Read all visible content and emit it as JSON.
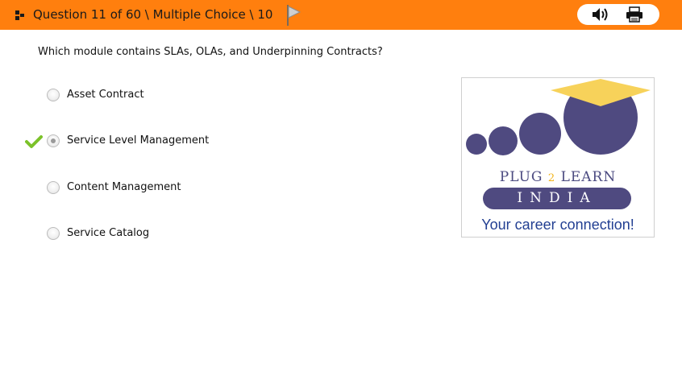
{
  "header": {
    "title": "Question 11 of 60 \\ Multiple Choice \\ 10",
    "background_color": "#ff7f0e",
    "question_icon": "question-marker-icon",
    "flag_icon": "flag-icon",
    "tools": [
      {
        "name": "audio",
        "icon": "speaker-icon"
      },
      {
        "name": "print",
        "icon": "printer-icon"
      }
    ]
  },
  "question": {
    "text": "Which module contains SLAs, OLAs, and Underpinning Contracts?"
  },
  "options": [
    {
      "label": "Asset Contract",
      "selected": false,
      "correct": false
    },
    {
      "label": "Service Level Management",
      "selected": true,
      "correct": true
    },
    {
      "label": "Content Management",
      "selected": false,
      "correct": false
    },
    {
      "label": "Service Catalog",
      "selected": false,
      "correct": false
    }
  ],
  "feedback": {
    "correct_icon": "green-checkmark-icon",
    "correct_color": "#7cc22a"
  },
  "logo": {
    "brand_pre": "PLUG",
    "brand_mid": "2",
    "brand_post": "LEARN",
    "country": "INDIA",
    "tagline": "Your career connection!",
    "colors": {
      "purple": "#4f4a80",
      "gold": "#f7d25a",
      "blue": "#223f92"
    }
  }
}
